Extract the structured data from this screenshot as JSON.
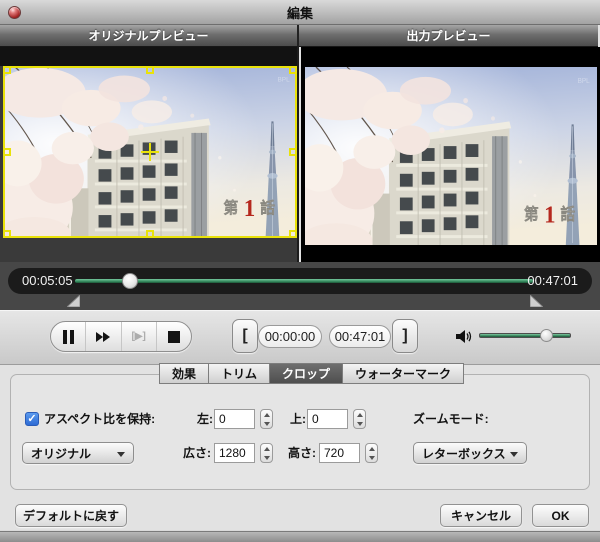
{
  "window": {
    "title": "編集"
  },
  "preview": {
    "original_label": "オリジナルプレビュー",
    "output_label": "出力プレビュー",
    "scene": {
      "episode_prefix": "第",
      "episode_number": "1",
      "episode_suffix": "話",
      "watermark": "BPL"
    }
  },
  "timeline": {
    "elapsed": "00:05:05",
    "total": "00:47:01",
    "progress_percent": 12
  },
  "trim": {
    "start_bracket": "[",
    "end_bracket": "]",
    "start_time": "00:00:00",
    "end_time": "00:47:01"
  },
  "transport": {
    "step_glyph": "[▶]"
  },
  "volume": {
    "percent": 73
  },
  "tabs": [
    {
      "label": "効果",
      "active": false
    },
    {
      "label": "トリム",
      "active": false
    },
    {
      "label": "クロップ",
      "active": true
    },
    {
      "label": "ウォーターマーク",
      "active": false
    }
  ],
  "crop": {
    "keep_aspect_label": "アスペクト比を保持:",
    "keep_aspect_checked": true,
    "check_glyph": "✓",
    "left_label": "左:",
    "left_value": "0",
    "top_label": "上:",
    "top_value": "0",
    "width_label": "広さ:",
    "width_value": "1280",
    "height_label": "高さ:",
    "height_value": "720",
    "zoom_mode_label": "ズームモード:",
    "aspect_select_value": "オリジナル",
    "zoom_select_value": "レターボックス"
  },
  "footer": {
    "default_label": "デフォルトに戻す",
    "cancel_label": "キャンセル",
    "ok_label": "OK"
  },
  "colors": {
    "accent_green": "#2f8257",
    "crop_yellow": "#e9e20a",
    "checkbox_blue": "#2e6bd4",
    "episode_red": "#b5281e"
  }
}
